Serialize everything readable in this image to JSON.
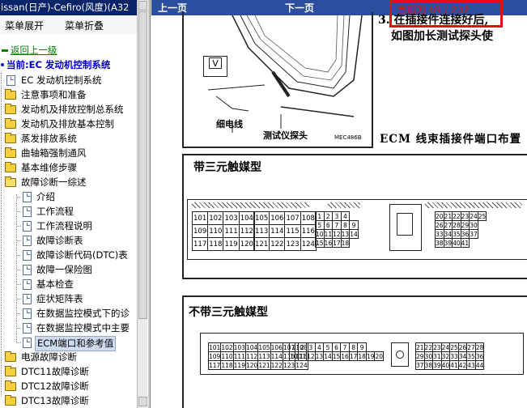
{
  "sidebar": {
    "title": "issan(日产)-Cefiro(风度)(A32",
    "toolbar": {
      "expand_label": "菜单展开",
      "collapse_label": "菜单折叠"
    },
    "back_link": "返回上一级",
    "current_label": "当前:EC 发动机控制系统",
    "items": [
      {
        "label": "EC 发动机控制系统",
        "icon": "document-icon"
      },
      {
        "label": "注意事项和准备",
        "icon": "folder-icon"
      },
      {
        "label": "发动机及排放控制总系统",
        "icon": "folder-icon"
      },
      {
        "label": "发动机及排放基本控制",
        "icon": "folder-icon"
      },
      {
        "label": "蒸发排放系统",
        "icon": "folder-icon"
      },
      {
        "label": "曲轴箱强制通风",
        "icon": "folder-icon"
      },
      {
        "label": "基本维修步骤",
        "icon": "folder-icon"
      },
      {
        "label": "故障诊断一综述",
        "icon": "folder-open-icon"
      }
    ],
    "subitems": [
      {
        "label": "介绍"
      },
      {
        "label": "工作流程"
      },
      {
        "label": "工作流程说明"
      },
      {
        "label": "故障诊断表"
      },
      {
        "label": "故障诊断代码(DTC)表"
      },
      {
        "label": "故障一保险图"
      },
      {
        "label": "基本检查"
      },
      {
        "label": "症状矩阵表"
      },
      {
        "label": "在数据监控模式下的诊"
      },
      {
        "label": "在数据监控模式中主要"
      },
      {
        "label": "ECM端口和参考值",
        "selected": true
      }
    ],
    "items_after": [
      {
        "label": "电源故障诊断"
      },
      {
        "label": "DTC11故障诊断"
      },
      {
        "label": "DTC12故障诊断"
      },
      {
        "label": "DTC13故障诊断"
      }
    ]
  },
  "nav": {
    "prev_label": "上一页",
    "next_label": "下一页"
  },
  "page_indicator": {
    "prefix": "当前为",
    "current": "69",
    "total": "232",
    "text": "当前为  69 / 232"
  },
  "document": {
    "step_text_1": "3.  在插接件连接好后,",
    "step_text_2": "如图加长测试探头使",
    "label_wire": "细电线",
    "label_probe": "测试仪探头",
    "figure_code": "MEC486B",
    "ecm_caption": "ECM 线束插接件端口布置",
    "section1_title": "带三元触媒型",
    "section2_title": "不带三元触媒型",
    "meter_symbol": "V",
    "s1_left_rows": [
      [
        "101",
        "102",
        "103",
        "104"
      ],
      [
        "109",
        "110",
        "111",
        "112"
      ],
      [
        "117",
        "118",
        "119",
        "120"
      ]
    ],
    "s1_mid_rows": [
      [
        "105",
        "106",
        "107",
        "108"
      ],
      [
        "113",
        "114",
        "115",
        "116"
      ],
      [
        "121",
        "122",
        "123",
        "124"
      ]
    ],
    "s1_small_rows": [
      [
        "1",
        "2",
        "3",
        "4"
      ],
      [
        "5",
        "6",
        "7",
        "8",
        "9"
      ],
      [
        "10",
        "11",
        "12",
        "13",
        "14"
      ],
      [
        "15",
        "16",
        "17",
        "18"
      ]
    ],
    "s1_right_rows": [
      [
        "20",
        "21",
        "22",
        "23",
        "24",
        "25"
      ],
      [
        "26",
        "27",
        "28",
        "29",
        "30"
      ],
      [
        "33",
        "34",
        "35",
        "36",
        "37"
      ],
      [
        "38",
        "39",
        "40",
        "41"
      ]
    ],
    "s2_left_rows": [
      [
        "101",
        "102",
        "103",
        "104",
        "105",
        "106",
        "107",
        "108"
      ],
      [
        "109",
        "110",
        "111",
        "112",
        "113",
        "114",
        "115",
        "116"
      ],
      [
        "117",
        "118",
        "119",
        "120",
        "121",
        "122",
        "123",
        "124"
      ]
    ],
    "s2_mid_rows": [
      [
        "1",
        "2",
        "3",
        "4",
        "5",
        "6",
        "7",
        "8",
        "9"
      ],
      [
        "10",
        "11",
        "12",
        "13",
        "14",
        "15",
        "16",
        "17",
        "18",
        "19",
        "20"
      ]
    ],
    "s2_right_rows": [
      [
        "21",
        "22",
        "23",
        "24",
        "25",
        "26",
        "27",
        "28"
      ],
      [
        "29",
        "30",
        "31",
        "32",
        "33",
        "34",
        "35",
        "36"
      ],
      [
        "37",
        "38",
        "39",
        "40",
        "41",
        "42",
        "43",
        "44"
      ]
    ]
  }
}
